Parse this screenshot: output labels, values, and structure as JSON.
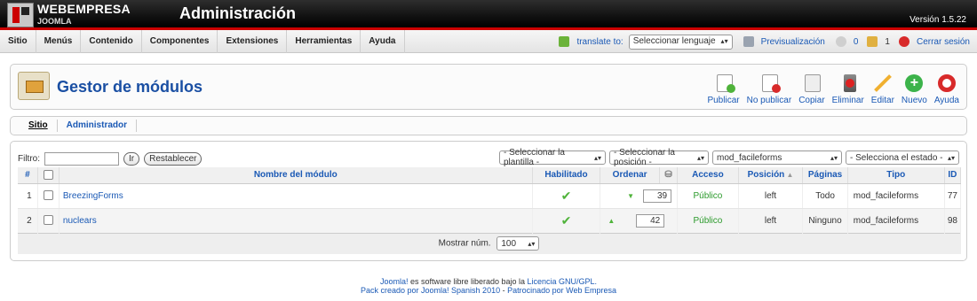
{
  "header": {
    "brand": "WEBEMPRESA",
    "brand_sub": "JOOMLA",
    "title": "Administración",
    "version": "Versión 1.5.22"
  },
  "menu": {
    "items": [
      "Sitio",
      "Menús",
      "Contenido",
      "Componentes",
      "Extensiones",
      "Herramientas",
      "Ayuda"
    ],
    "translate_label": "translate to:",
    "language_select": "Seleccionar lenguaje",
    "preview": "Previsualización",
    "messages_count": "0",
    "users_count": "1",
    "logout": "Cerrar sesión"
  },
  "toolbar": {
    "title": "Gestor de módulos",
    "buttons": [
      {
        "label": "Publicar",
        "icon": "publish-icon"
      },
      {
        "label": "No publicar",
        "icon": "unpublish-icon"
      },
      {
        "label": "Copiar",
        "icon": "copy-icon"
      },
      {
        "label": "Eliminar",
        "icon": "delete-icon"
      },
      {
        "label": "Editar",
        "icon": "edit-icon"
      },
      {
        "label": "Nuevo",
        "icon": "new-icon"
      },
      {
        "label": "Ayuda",
        "icon": "help-icon"
      }
    ]
  },
  "subnav": {
    "tabs": [
      "Sitio",
      "Administrador"
    ]
  },
  "filters": {
    "label": "Filtro:",
    "go": "Ir",
    "reset": "Restablecer",
    "template": "- Seleccionar la plantilla -",
    "position": "- Seleccionar la posición -",
    "type": "mod_facileforms",
    "state": "- Selecciona el estado -"
  },
  "table": {
    "headers": {
      "num": "#",
      "name": "Nombre del módulo",
      "enabled": "Habilitado",
      "order": "Ordenar",
      "access": "Acceso",
      "position": "Posición",
      "pages": "Páginas",
      "type": "Tipo",
      "id": "ID"
    },
    "rows": [
      {
        "num": "1",
        "name": "BreezingForms",
        "order": "39",
        "access": "Público",
        "position": "left",
        "pages": "Todo",
        "type": "mod_facileforms",
        "id": "77"
      },
      {
        "num": "2",
        "name": "nuclears",
        "order": "42",
        "access": "Público",
        "position": "left",
        "pages": "Ninguno",
        "type": "mod_facileforms",
        "id": "98"
      }
    ],
    "show_label": "Mostrar núm.",
    "show_value": "100"
  },
  "footer": {
    "line1_a": "Joomla!",
    "line1_b": " es software libre liberado bajo la ",
    "line1_c": "Licencia GNU/GPL.",
    "line2_a": "Pack creado por Joomla! Spanish 2010",
    "line2_b": " - ",
    "line2_c": "Patrocinado por Web Empresa"
  },
  "colors": {
    "accent": "#1a59b5",
    "header_red": "#cc0000",
    "check_green": "#4fb33a"
  }
}
